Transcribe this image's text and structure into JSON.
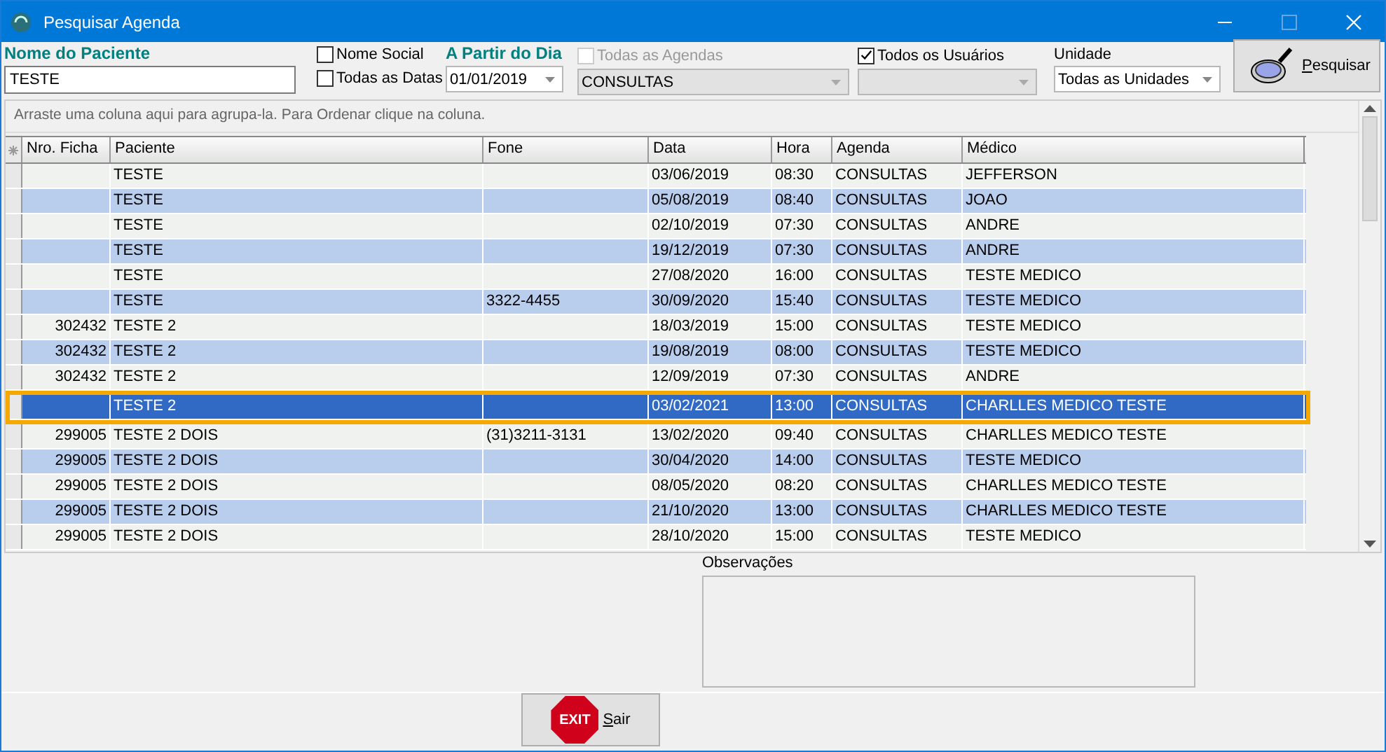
{
  "window": {
    "title": "Pesquisar Agenda"
  },
  "patient_name": {
    "label": "Nome do Paciente",
    "value": "TESTE"
  },
  "options": [
    {
      "label": "Nome Social",
      "checked": false
    },
    {
      "label": "Todas as Datas",
      "checked": false
    }
  ],
  "from_date": {
    "label": "A Partir do Dia",
    "value": "01/01/2019"
  },
  "agendas": {
    "label": "Todas as Agendas",
    "checked": false,
    "disabled": true,
    "value": "CONSULTAS"
  },
  "users": {
    "label": "Todos os Usuários",
    "checked": true
  },
  "unit": {
    "label": "Unidade",
    "value": "Todas as Unidades"
  },
  "search_button": {
    "label": "Pesquisar"
  },
  "group_hint": "Arraste uma coluna aqui para agrupa-la. Para Ordenar clique na coluna.",
  "table": {
    "columns": [
      "Nro. Ficha",
      "Paciente",
      "Fone",
      "Data",
      "Hora",
      "Agenda",
      "Médico"
    ],
    "rows": [
      {
        "cells": [
          "",
          "TESTE",
          "",
          "03/06/2019",
          "08:30",
          "CONSULTAS",
          "JEFFERSON"
        ],
        "selected": false
      },
      {
        "cells": [
          "",
          "TESTE",
          "",
          "05/08/2019",
          "08:40",
          "CONSULTAS",
          "JOAO"
        ],
        "selected": false
      },
      {
        "cells": [
          "",
          "TESTE",
          "",
          "02/10/2019",
          "07:30",
          "CONSULTAS",
          "ANDRE"
        ],
        "selected": false
      },
      {
        "cells": [
          "",
          "TESTE",
          "",
          "19/12/2019",
          "07:30",
          "CONSULTAS",
          "ANDRE"
        ],
        "selected": false
      },
      {
        "cells": [
          "",
          "TESTE",
          "",
          "27/08/2020",
          "16:00",
          "CONSULTAS",
          "TESTE MEDICO"
        ],
        "selected": false
      },
      {
        "cells": [
          "",
          "TESTE",
          "3322-4455",
          "30/09/2020",
          "15:40",
          "CONSULTAS",
          "TESTE MEDICO"
        ],
        "selected": false
      },
      {
        "cells": [
          "302432",
          "TESTE 2",
          "",
          "18/03/2019",
          "15:00",
          "CONSULTAS",
          "TESTE MEDICO"
        ],
        "selected": false
      },
      {
        "cells": [
          "302432",
          "TESTE 2",
          "",
          "19/08/2019",
          "08:00",
          "CONSULTAS",
          "TESTE MEDICO"
        ],
        "selected": false
      },
      {
        "cells": [
          "302432",
          "TESTE 2",
          "",
          "12/09/2019",
          "07:30",
          "CONSULTAS",
          "ANDRE"
        ],
        "selected": false
      },
      {
        "cells": [
          "",
          "TESTE 2",
          "",
          "03/02/2021",
          "13:00",
          "CONSULTAS",
          "CHARLLES MEDICO TESTE"
        ],
        "selected": true
      },
      {
        "cells": [
          "299005",
          "TESTE 2 DOIS",
          "(31)3211-3131",
          "13/02/2020",
          "09:40",
          "CONSULTAS",
          "CHARLLES MEDICO TESTE"
        ],
        "selected": false
      },
      {
        "cells": [
          "299005",
          "TESTE 2 DOIS",
          "",
          "30/04/2020",
          "14:00",
          "CONSULTAS",
          "TESTE MEDICO"
        ],
        "selected": false
      },
      {
        "cells": [
          "299005",
          "TESTE 2 DOIS",
          "",
          "08/05/2020",
          "08:20",
          "CONSULTAS",
          "CHARLLES MEDICO TESTE"
        ],
        "selected": false
      },
      {
        "cells": [
          "299005",
          "TESTE 2 DOIS",
          "",
          "21/10/2020",
          "13:00",
          "CONSULTAS",
          "CHARLLES MEDICO TESTE"
        ],
        "selected": false
      },
      {
        "cells": [
          "299005",
          "TESTE 2 DOIS",
          "",
          "28/10/2020",
          "15:00",
          "CONSULTAS",
          "TESTE MEDICO"
        ],
        "selected": false
      }
    ]
  },
  "notes": {
    "label": "Observações"
  },
  "exit_button": {
    "sign": "EXIT",
    "label": "Sair"
  }
}
